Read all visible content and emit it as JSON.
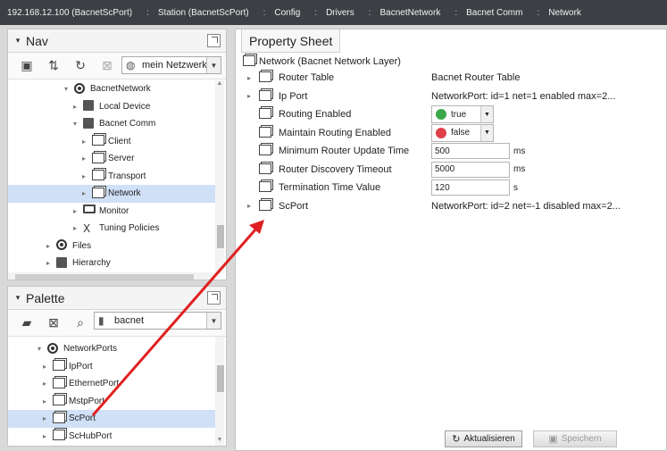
{
  "breadcrumb": [
    "192.168.12.100 (BacnetScPort)",
    "Station (BacnetScPort)",
    "Config",
    "Drivers",
    "BacnetNetwork",
    "Bacnet Comm",
    "Network"
  ],
  "nav": {
    "title": "Nav",
    "combo_value": "mein Netzwerk",
    "tree": [
      {
        "label": "BacnetNetwork",
        "indent": 3,
        "expander": "▾",
        "icon": "round"
      },
      {
        "label": "Local Device",
        "indent": 4,
        "expander": "▸",
        "icon": "device"
      },
      {
        "label": "Bacnet Comm",
        "indent": 4,
        "expander": "▾",
        "icon": "device"
      },
      {
        "label": "Client",
        "indent": 5,
        "expander": "▸",
        "icon": "folder"
      },
      {
        "label": "Server",
        "indent": 5,
        "expander": "▸",
        "icon": "folder"
      },
      {
        "label": "Transport",
        "indent": 5,
        "expander": "▸",
        "icon": "folder"
      },
      {
        "label": "Network",
        "indent": 5,
        "expander": "▸",
        "icon": "folder",
        "selected": true
      },
      {
        "label": "Monitor",
        "indent": 4,
        "expander": "▸",
        "icon": "monitor"
      },
      {
        "label": "Tuning Policies",
        "indent": 4,
        "expander": "▸",
        "icon": "glyph"
      },
      {
        "label": "Files",
        "indent": 1,
        "expander": "▸",
        "icon": "round"
      },
      {
        "label": "Hierarchy",
        "indent": 1,
        "expander": "▸",
        "icon": "device"
      }
    ]
  },
  "palette": {
    "title": "Palette",
    "combo_value": "bacnet",
    "tree": [
      {
        "label": "NetworkPorts",
        "indent": 0,
        "expander": "▾",
        "icon": "round"
      },
      {
        "label": "IpPort",
        "indent": 1,
        "expander": "▸",
        "icon": "folder"
      },
      {
        "label": "EthernetPort",
        "indent": 1,
        "expander": "▸",
        "icon": "folder"
      },
      {
        "label": "MstpPort",
        "indent": 1,
        "expander": "▸",
        "icon": "folder"
      },
      {
        "label": "ScPort",
        "indent": 1,
        "expander": "▸",
        "icon": "folder",
        "selected": true
      },
      {
        "label": "ScHubPort",
        "indent": 1,
        "expander": "▸",
        "icon": "folder"
      }
    ]
  },
  "property_sheet": {
    "tab": "Property Sheet",
    "root_label": "Network  (Bacnet Network Layer)",
    "rows": [
      {
        "name": "Router Table",
        "expander": "▸",
        "kind": "text",
        "value": "Bacnet Router Table"
      },
      {
        "name": "Ip Port",
        "expander": "▸",
        "kind": "text",
        "value": "NetworkPort: id=1 net=1 enabled max=2..."
      },
      {
        "name": "Routing Enabled",
        "expander": "",
        "kind": "bool",
        "value": "true",
        "color": "#3aa84a"
      },
      {
        "name": "Maintain Routing Enabled",
        "expander": "",
        "kind": "bool",
        "value": "false",
        "color": "#e0404a"
      },
      {
        "name": "Minimum Router Update Time",
        "expander": "",
        "kind": "field",
        "value": "500",
        "unit": "ms"
      },
      {
        "name": "Router Discovery Timeout",
        "expander": "",
        "kind": "field",
        "value": "5000",
        "unit": "ms"
      },
      {
        "name": "Termination Time Value",
        "expander": "",
        "kind": "field",
        "value": "120",
        "unit": "s"
      },
      {
        "name": "ScPort",
        "expander": "▸",
        "kind": "text",
        "value": "NetworkPort: id=2 net=-1 disabled max=2..."
      }
    ],
    "refresh_label": "Aktualisieren",
    "save_label": "Speichern"
  },
  "colors": {
    "accent_arrow": "#e02020",
    "selection": "#cfe0f7",
    "breadcrumb_bg": "#3c3f44"
  }
}
